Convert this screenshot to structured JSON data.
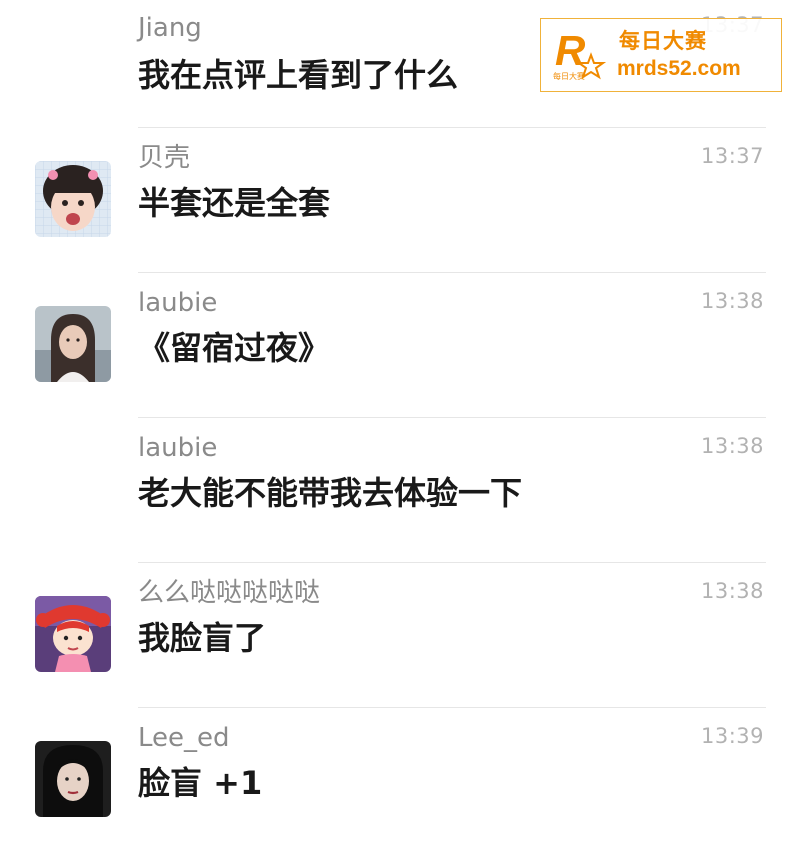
{
  "messages": [
    {
      "sender": "Jiang",
      "time": "13:37",
      "text": "我在点评上看到了什么",
      "avatar": "none"
    },
    {
      "sender": "贝壳",
      "time": "13:37",
      "text": "半套还是全套",
      "avatar": "child-photo-avatar"
    },
    {
      "sender": "laubie",
      "time": "13:38",
      "text": "《留宿过夜》",
      "avatar": "woman-photo-avatar"
    },
    {
      "sender": "laubie",
      "time": "13:38",
      "text": "老大能不能带我去体验一下",
      "avatar": "none"
    },
    {
      "sender": "么么哒哒哒哒哒",
      "time": "13:38",
      "text": "我脸盲了",
      "avatar": "cartoon-girl-avatar"
    },
    {
      "sender": "Lee_ed",
      "time": "13:39",
      "text": "脸盲 +1",
      "avatar": "dark-portrait-avatar"
    }
  ],
  "watermark": {
    "title": "每日大赛",
    "url": "mrds52.com",
    "logo_letter": "R",
    "logo_small_text": "每日大赛"
  },
  "colors": {
    "sender": "#8a8a8a",
    "time": "#b2b2b2",
    "text": "#191919",
    "divider": "#e6e6e6",
    "watermark": "#f08a00"
  }
}
